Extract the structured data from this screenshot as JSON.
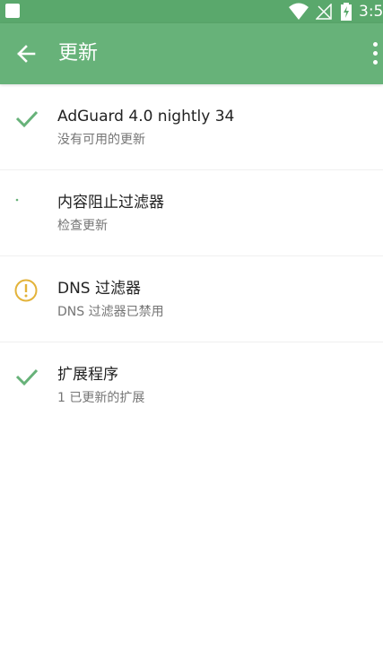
{
  "status_bar": {
    "time": "3:5"
  },
  "app_bar": {
    "title": "更新"
  },
  "items": [
    {
      "title": "AdGuard 4.0 nightly 34",
      "subtitle": "没有可用的更新",
      "status_icon": "check-icon"
    },
    {
      "title": "内容阻止过滤器",
      "subtitle": "检查更新",
      "status_icon": "loading-dot-icon"
    },
    {
      "title": "DNS 过滤器",
      "subtitle": "DNS 过滤器已禁用",
      "status_icon": "warning-icon"
    },
    {
      "title": "扩展程序",
      "subtitle": "1 已更新的扩展",
      "status_icon": "check-icon"
    }
  ],
  "colors": {
    "status_bar": "#5aa86c",
    "app_bar": "#67b279",
    "check": "#67b279",
    "warning": "#e3b33a"
  }
}
